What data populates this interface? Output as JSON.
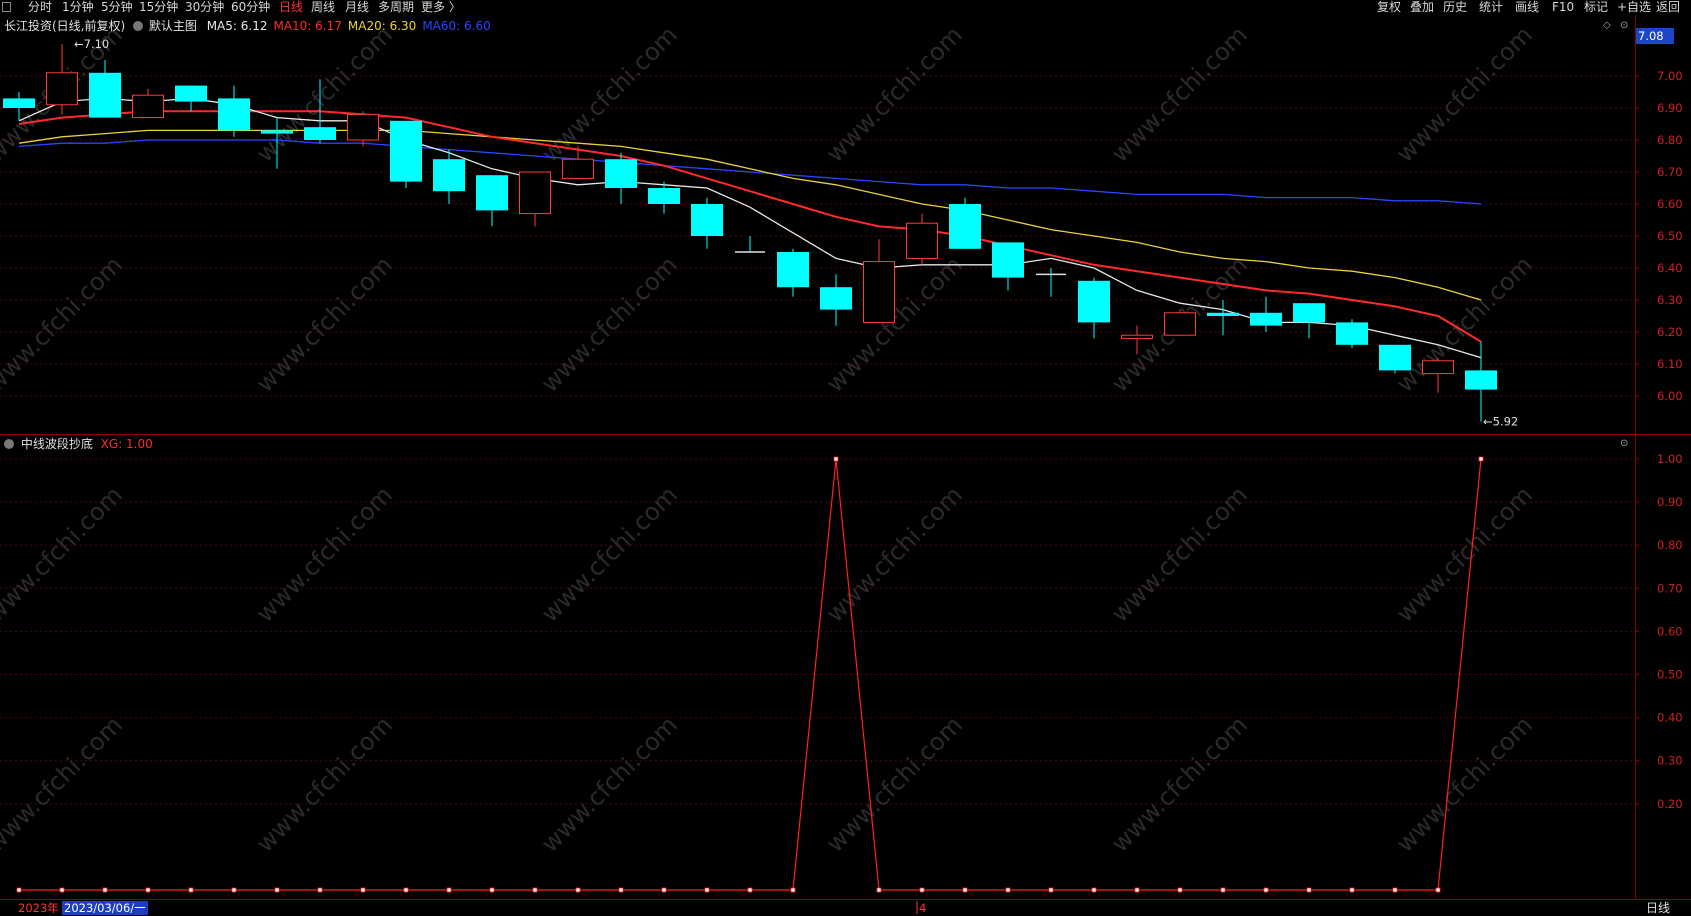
{
  "toolbar": {
    "periods": [
      "分时",
      "1分钟",
      "5分钟",
      "15分钟",
      "30分钟",
      "60分钟",
      "日线",
      "周线",
      "月线",
      "多周期",
      "更多 〉"
    ],
    "active_period": "日线",
    "right_items": [
      "复权",
      "叠加",
      "历史",
      "统计",
      "画线",
      "F10",
      "标记",
      "+自选",
      "返回"
    ]
  },
  "main_panel": {
    "stock_title": "长江投资(日线,前复权)",
    "template": "默认主图",
    "ma": [
      {
        "label": "MA5: 6.12",
        "color": "#e8e8e8"
      },
      {
        "label": "MA10: 6.17",
        "color": "#ff2a2a"
      },
      {
        "label": "MA20: 6.30",
        "color": "#e8d23a"
      },
      {
        "label": "MA60: 6.60",
        "color": "#2846ff"
      }
    ],
    "current_price": "7.08",
    "high_marker": "7.10",
    "low_marker": "5.92",
    "y_ticks": [
      "7.00",
      "6.90",
      "6.80",
      "6.70",
      "6.60",
      "6.50",
      "6.40",
      "6.30",
      "6.20",
      "6.10",
      "6.00"
    ]
  },
  "sub_panel": {
    "indicator_name": "中线波段抄底",
    "xg_label": "XG: 1.00",
    "y_ticks": [
      "1.00",
      "0.90",
      "0.80",
      "0.70",
      "0.60",
      "0.50",
      "0.40",
      "0.30",
      "0.20"
    ]
  },
  "status_bar": {
    "year": "2023年",
    "date": "2023/03/06/一",
    "mid_marker": "4",
    "period": "日线"
  },
  "colors": {
    "up": "#ff3b3b",
    "down": "#00ffff",
    "ma5": "#e8e8e8",
    "ma10": "#ff2a2a",
    "ma20": "#e8d23a",
    "ma60": "#2846ff",
    "grid": "#5a0000",
    "xg": "#ff2020"
  },
  "chart_data": {
    "type": "candlestick",
    "y_range": [
      5.92,
      7.13
    ],
    "candles": [
      {
        "o": 6.93,
        "h": 6.95,
        "l": 6.86,
        "c": 6.9
      },
      {
        "o": 6.91,
        "h": 7.1,
        "l": 6.88,
        "c": 7.01
      },
      {
        "o": 7.01,
        "h": 7.05,
        "l": 6.87,
        "c": 6.87
      },
      {
        "o": 6.87,
        "h": 6.96,
        "l": 6.87,
        "c": 6.94
      },
      {
        "o": 6.97,
        "h": 6.97,
        "l": 6.89,
        "c": 6.92
      },
      {
        "o": 6.93,
        "h": 6.97,
        "l": 6.81,
        "c": 6.83
      },
      {
        "o": 6.83,
        "h": 6.87,
        "l": 6.71,
        "c": 6.82
      },
      {
        "o": 6.84,
        "h": 6.99,
        "l": 6.79,
        "c": 6.8
      },
      {
        "o": 6.8,
        "h": 6.89,
        "l": 6.78,
        "c": 6.88
      },
      {
        "o": 6.86,
        "h": 6.85,
        "l": 6.65,
        "c": 6.67
      },
      {
        "o": 6.74,
        "h": 6.77,
        "l": 6.6,
        "c": 6.64
      },
      {
        "o": 6.69,
        "h": 6.69,
        "l": 6.53,
        "c": 6.58
      },
      {
        "o": 6.57,
        "h": 6.7,
        "l": 6.53,
        "c": 6.7
      },
      {
        "o": 6.68,
        "h": 6.78,
        "l": 6.68,
        "c": 6.74
      },
      {
        "o": 6.74,
        "h": 6.76,
        "l": 6.6,
        "c": 6.65
      },
      {
        "o": 6.65,
        "h": 6.67,
        "l": 6.57,
        "c": 6.6
      },
      {
        "o": 6.6,
        "h": 6.62,
        "l": 6.46,
        "c": 6.5
      },
      {
        "o": 6.45,
        "h": 6.5,
        "l": 6.45,
        "c": 6.45
      },
      {
        "o": 6.45,
        "h": 6.46,
        "l": 6.31,
        "c": 6.34
      },
      {
        "o": 6.34,
        "h": 6.38,
        "l": 6.22,
        "c": 6.27
      },
      {
        "o": 6.23,
        "h": 6.49,
        "l": 6.23,
        "c": 6.42
      },
      {
        "o": 6.43,
        "h": 6.57,
        "l": 6.41,
        "c": 6.54
      },
      {
        "o": 6.6,
        "h": 6.62,
        "l": 6.46,
        "c": 6.46
      },
      {
        "o": 6.48,
        "h": 6.48,
        "l": 6.33,
        "c": 6.37
      },
      {
        "o": 6.38,
        "h": 6.4,
        "l": 6.31,
        "c": 6.38
      },
      {
        "o": 6.36,
        "h": 6.37,
        "l": 6.18,
        "c": 6.23
      },
      {
        "o": 6.18,
        "h": 6.22,
        "l": 6.13,
        "c": 6.19
      },
      {
        "o": 6.19,
        "h": 6.27,
        "l": 6.19,
        "c": 6.26
      },
      {
        "o": 6.26,
        "h": 6.3,
        "l": 6.19,
        "c": 6.25
      },
      {
        "o": 6.26,
        "h": 6.31,
        "l": 6.2,
        "c": 6.22
      },
      {
        "o": 6.29,
        "h": 6.29,
        "l": 6.18,
        "c": 6.23
      },
      {
        "o": 6.23,
        "h": 6.24,
        "l": 6.15,
        "c": 6.16
      },
      {
        "o": 6.16,
        "h": 6.16,
        "l": 6.07,
        "c": 6.08
      },
      {
        "o": 6.07,
        "h": 6.12,
        "l": 6.01,
        "c": 6.11
      },
      {
        "o": 6.08,
        "h": 6.17,
        "l": 5.92,
        "c": 6.02
      }
    ],
    "ma5": [
      6.86,
      6.92,
      6.93,
      6.92,
      6.93,
      6.91,
      6.87,
      6.86,
      6.86,
      6.8,
      6.76,
      6.71,
      6.68,
      6.66,
      6.67,
      6.66,
      6.65,
      6.59,
      6.51,
      6.43,
      6.4,
      6.41,
      6.41,
      6.41,
      6.43,
      6.4,
      6.33,
      6.29,
      6.27,
      6.23,
      6.23,
      6.22,
      6.19,
      6.16,
      6.12
    ],
    "ma10": [
      6.85,
      6.87,
      6.88,
      6.89,
      6.89,
      6.89,
      6.89,
      6.89,
      6.88,
      6.87,
      6.84,
      6.81,
      6.79,
      6.77,
      6.75,
      6.72,
      6.68,
      6.64,
      6.6,
      6.56,
      6.53,
      6.52,
      6.5,
      6.47,
      6.44,
      6.41,
      6.39,
      6.37,
      6.35,
      6.33,
      6.32,
      6.3,
      6.28,
      6.25,
      6.17
    ],
    "ma20": [
      6.79,
      6.81,
      6.82,
      6.83,
      6.83,
      6.83,
      6.83,
      6.83,
      6.83,
      6.83,
      6.82,
      6.81,
      6.8,
      6.79,
      6.78,
      6.76,
      6.74,
      6.71,
      6.68,
      6.66,
      6.63,
      6.6,
      6.58,
      6.55,
      6.52,
      6.5,
      6.48,
      6.45,
      6.43,
      6.42,
      6.4,
      6.39,
      6.37,
      6.34,
      6.3
    ],
    "ma60": [
      6.78,
      6.79,
      6.79,
      6.8,
      6.8,
      6.8,
      6.8,
      6.79,
      6.79,
      6.78,
      6.77,
      6.76,
      6.75,
      6.74,
      6.73,
      6.72,
      6.71,
      6.7,
      6.69,
      6.68,
      6.67,
      6.66,
      6.66,
      6.65,
      6.65,
      6.64,
      6.63,
      6.63,
      6.63,
      6.62,
      6.62,
      6.62,
      6.61,
      6.61,
      6.6
    ],
    "xg": [
      0,
      0,
      0,
      0,
      0,
      0,
      0,
      0,
      0,
      0,
      0,
      0,
      0,
      0,
      0,
      0,
      0,
      0,
      0,
      1,
      0,
      0,
      0,
      0,
      0,
      0,
      0,
      0,
      0,
      0,
      0,
      0,
      0,
      0,
      1
    ],
    "xg_range": [
      0,
      1.0
    ]
  }
}
